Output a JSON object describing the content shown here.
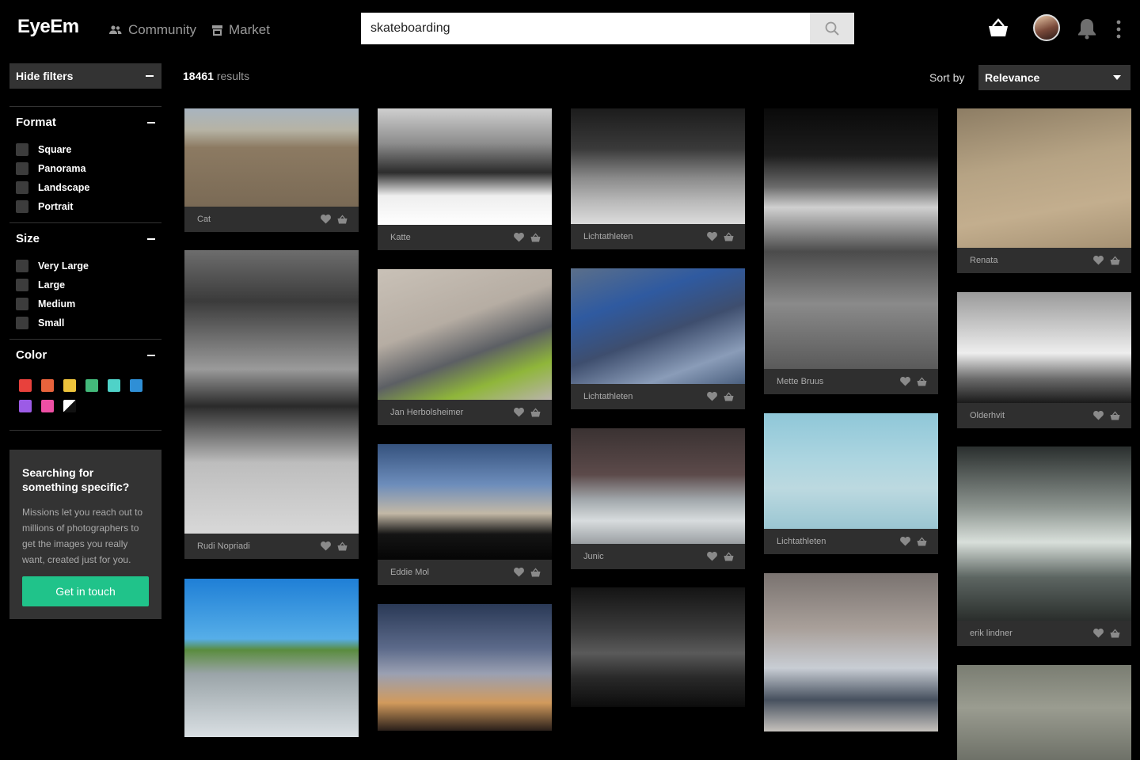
{
  "header": {
    "logo": "EyeEm",
    "nav": [
      {
        "label": "Community",
        "icon": "people-icon"
      },
      {
        "label": "Market",
        "icon": "market-icon"
      }
    ],
    "search_value": "skateboarding",
    "search_icon": "search-icon"
  },
  "sidebar": {
    "hide_filters": "Hide filters",
    "format": {
      "title": "Format",
      "options": [
        "Square",
        "Panorama",
        "Landscape",
        "Portrait"
      ]
    },
    "size": {
      "title": "Size",
      "options": [
        "Very Large",
        "Large",
        "Medium",
        "Small"
      ]
    },
    "color": {
      "title": "Color",
      "swatches": [
        "#e8413c",
        "#e8633c",
        "#eec43c",
        "#43b97a",
        "#4fd2c8",
        "#2f8fd6",
        "#9c5be6",
        "#ee4fa4",
        "bw"
      ]
    },
    "promo": {
      "title": "Searching for something specific?",
      "text": "Missions let you reach out to millions of photographers to get the images you really want, created just for you.",
      "button": "Get in touch"
    }
  },
  "toolbar": {
    "count": "18461",
    "count_label": "results",
    "sort_label": "Sort by",
    "sort_value": "Relevance"
  },
  "photos": [
    {
      "author": "Cat"
    },
    {
      "author": "Rudi Nopriadi"
    },
    {
      "author": ""
    },
    {
      "author": "Katte"
    },
    {
      "author": "Jan Herbolsheimer"
    },
    {
      "author": "Eddie Mol"
    },
    {
      "author": ""
    },
    {
      "author": "Lichtathleten"
    },
    {
      "author": "Lichtathleten"
    },
    {
      "author": "Junic"
    },
    {
      "author": ""
    },
    {
      "author": "Mette Bruus"
    },
    {
      "author": "Lichtathleten"
    },
    {
      "author": ""
    },
    {
      "author": "Renata"
    },
    {
      "author": "Olderhvit"
    },
    {
      "author": "erik lindner"
    },
    {
      "author": ""
    }
  ]
}
